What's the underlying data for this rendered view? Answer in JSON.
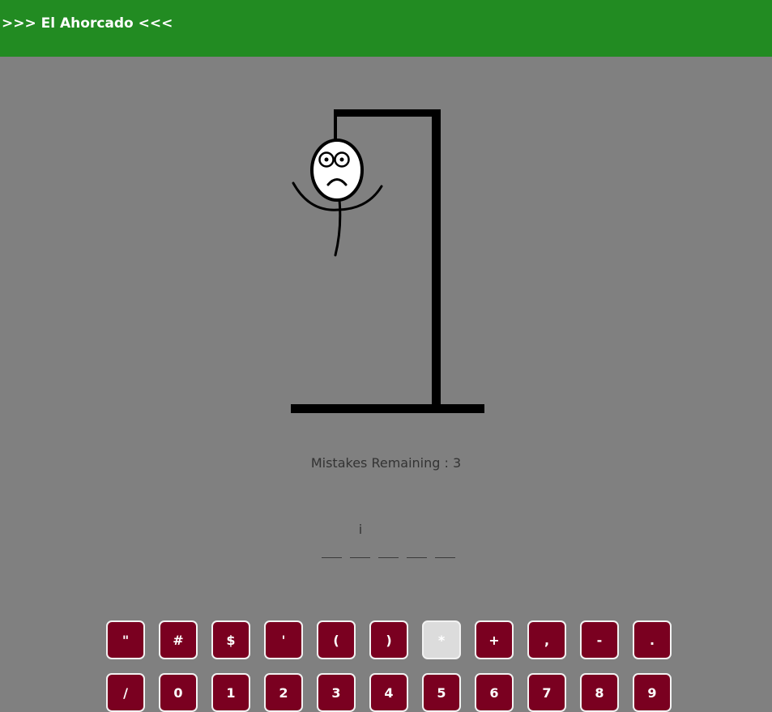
{
  "header": {
    "title": ">>> El Ahorcado <<<"
  },
  "status": {
    "mistakes_label": "Mistakes Remaining : ",
    "mistakes_remaining": "3"
  },
  "word": {
    "slots": [
      "",
      "",
      "",
      "",
      ""
    ],
    "revealed_letter": "i"
  },
  "keyboard": {
    "rows": [
      [
        "\"",
        "#",
        "$",
        "'",
        "(",
        ")",
        "*",
        "+",
        ",",
        "-",
        "."
      ],
      [
        "/",
        "0",
        "1",
        "2",
        "3",
        "4",
        "5",
        "6",
        "7",
        "8",
        "9"
      ]
    ],
    "used_keys": [
      "*"
    ]
  },
  "colors": {
    "background": "#808080",
    "header": "#228b22",
    "key": "#7a0020",
    "key_used": "#dcdcdc",
    "gallows": "#000000"
  }
}
